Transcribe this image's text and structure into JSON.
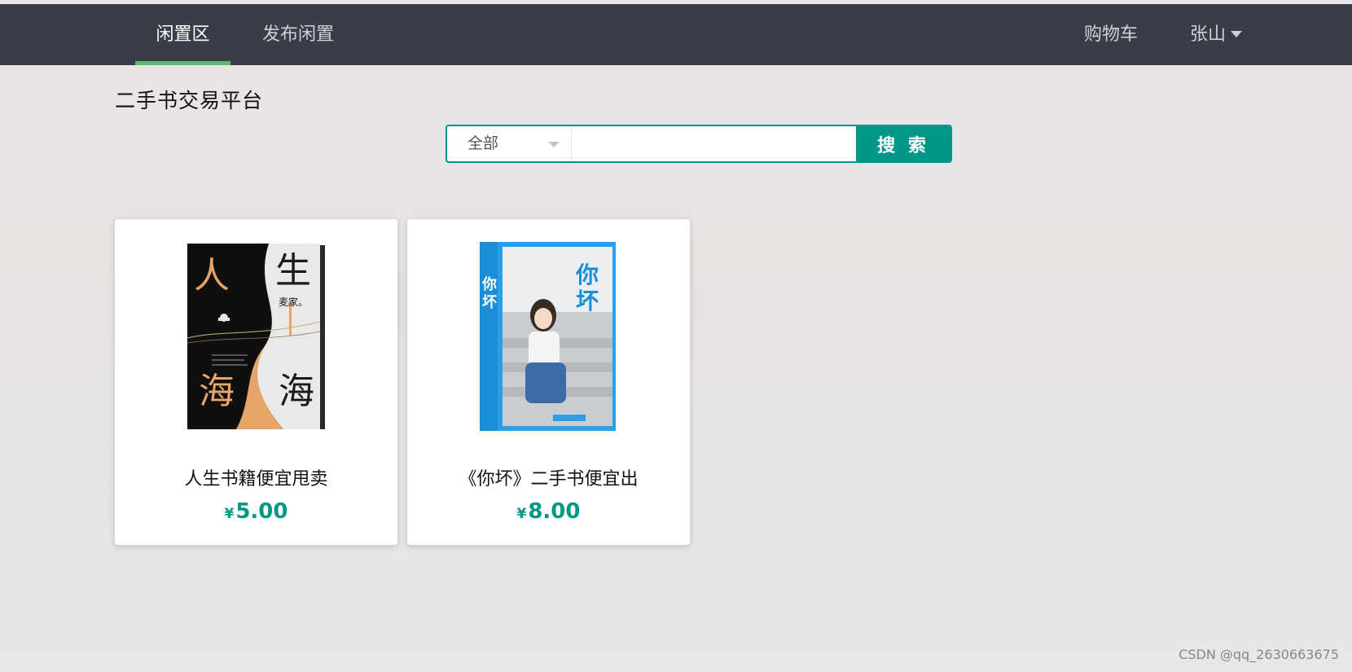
{
  "nav": {
    "left": [
      {
        "label": "闲置区",
        "active": true
      },
      {
        "label": "发布闲置",
        "active": false
      }
    ],
    "right": {
      "cart": "购物车",
      "user": "张山"
    }
  },
  "site_title": "二手书交易平台",
  "search": {
    "category": "全部",
    "query": "",
    "button_label": "搜 索"
  },
  "products": [
    {
      "name": "人生书籍便宜甩卖",
      "currency": "¥",
      "price": "5.00",
      "cover_text": "人生海海",
      "cover_author": "麦家。"
    },
    {
      "name": "《你坏》二手书便宜出",
      "currency": "¥",
      "price": "8.00",
      "cover_text": "你坏"
    }
  ],
  "watermark": "CSDN @qq_2630663675",
  "colors": {
    "topbar": "#393d49",
    "accent": "#009688",
    "active_indicator": "#5fb878"
  }
}
